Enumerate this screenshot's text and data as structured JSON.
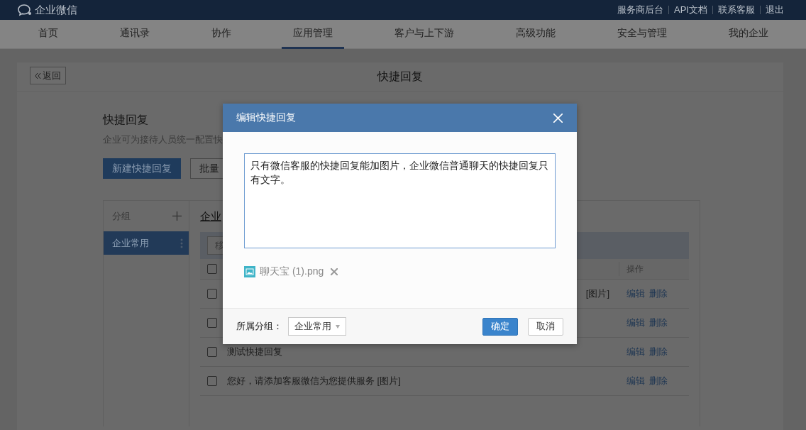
{
  "top_bar": {
    "logo": "企业微信",
    "links": [
      "服务商后台",
      "API文档",
      "联系客服",
      "退出"
    ]
  },
  "nav": [
    {
      "label": "首页",
      "selected": false
    },
    {
      "label": "通讯录",
      "selected": false
    },
    {
      "label": "协作",
      "selected": false
    },
    {
      "label": "应用管理",
      "selected": true
    },
    {
      "label": "客户与上下游",
      "selected": false
    },
    {
      "label": "高级功能",
      "selected": false
    },
    {
      "label": "安全与管理",
      "selected": false
    },
    {
      "label": "我的企业",
      "selected": false
    }
  ],
  "page_header": {
    "back_button": "返回",
    "title": "快捷回复"
  },
  "section": {
    "title": "快捷回复",
    "description": "企业可为接待人员统一配置快",
    "buttons": [
      {
        "label": "新建快捷回复",
        "kind": "primary"
      },
      {
        "label": "批量",
        "kind": "default"
      }
    ]
  },
  "groups": {
    "title": "分组",
    "items": [
      {
        "label": "企业常用",
        "selected": true
      }
    ]
  },
  "list": {
    "title": "企业",
    "toolbar_button": "移",
    "header_checked": false,
    "columns": [
      "操作"
    ],
    "rows": [
      {
        "text": "[图片]",
        "checked": false,
        "actions": [
          "编辑",
          "删除"
        ]
      },
      {
        "checked": false,
        "actions": [
          "编辑",
          "删除"
        ]
      },
      {
        "text": "测试快捷回复",
        "checked": false,
        "actions": [
          "编辑",
          "删除"
        ]
      },
      {
        "text": "您好，请添加客服微信为您提供服务 [图片]",
        "checked": false,
        "actions": [
          "编辑",
          "删除"
        ]
      }
    ]
  },
  "modal": {
    "title": "编辑快捷回复",
    "content": "只有微信客服的快捷回复能加图片，企业微信普通聊天的快捷回复只有文字。",
    "attachment": "聊天宝 (1).png",
    "group_label": "所属分组：",
    "group_value": "企业常用",
    "confirm": "确定",
    "cancel": "取消"
  }
}
